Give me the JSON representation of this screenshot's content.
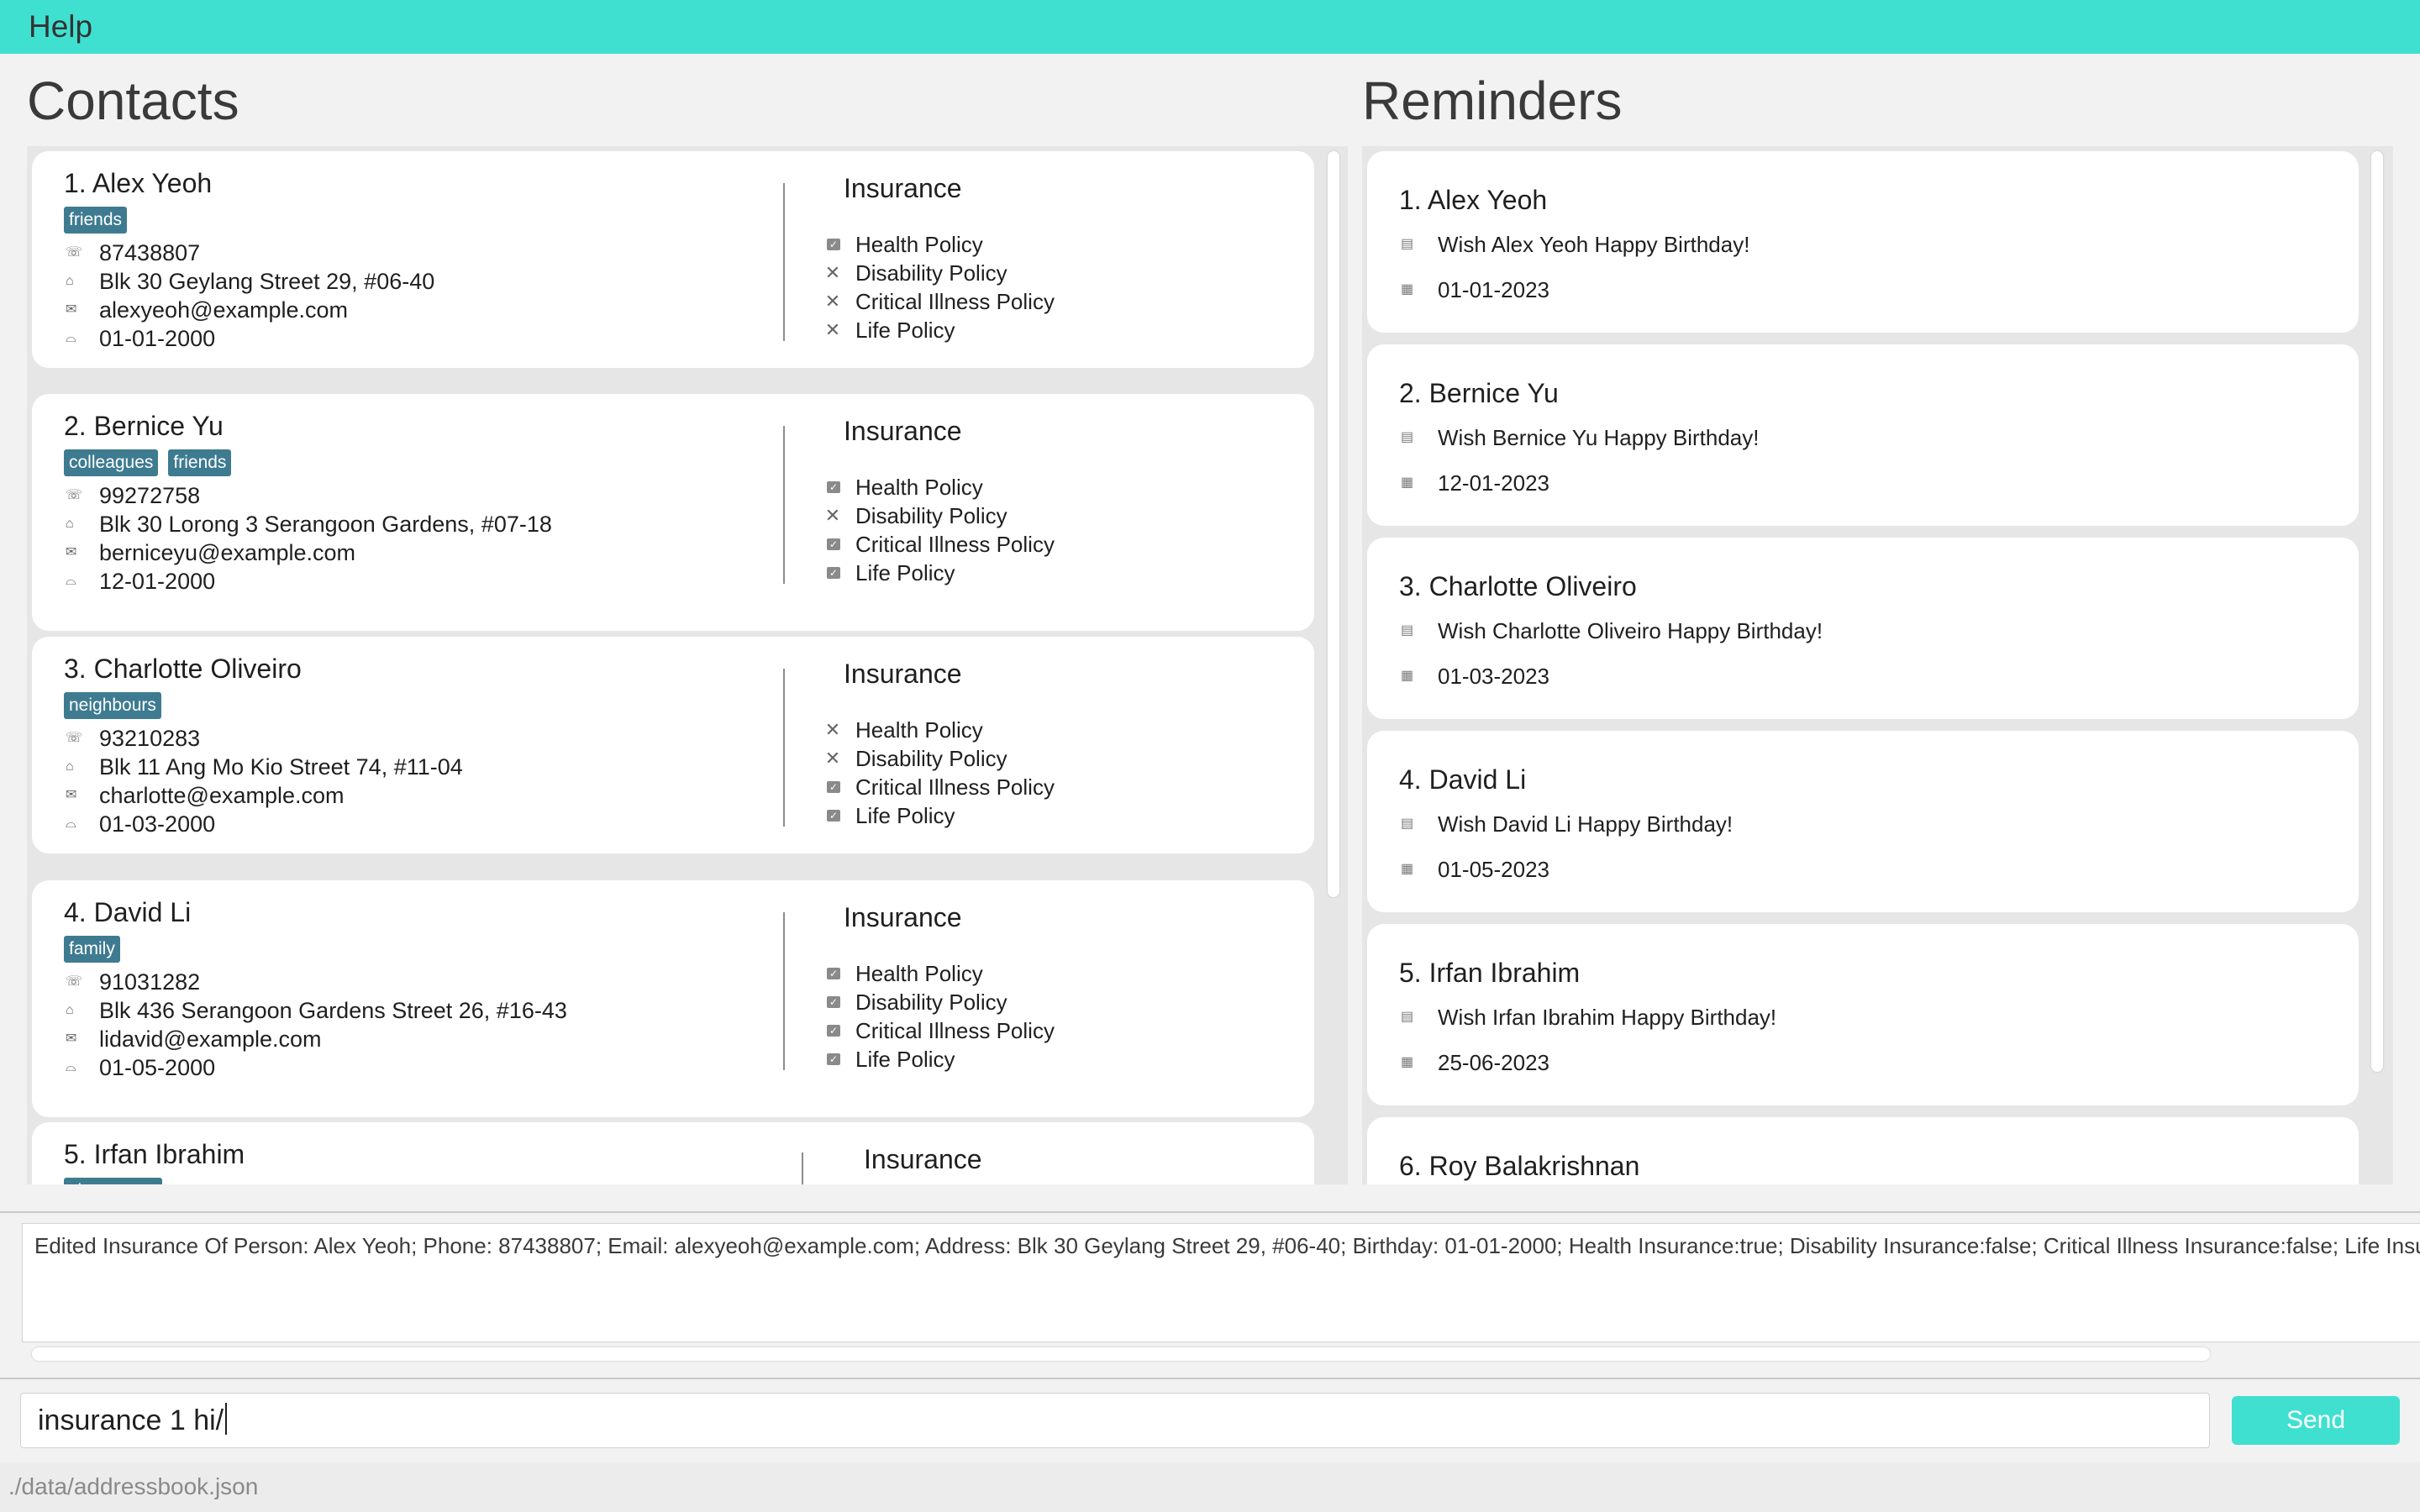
{
  "menu": {
    "help_label": "Help"
  },
  "contacts": {
    "title": "Contacts",
    "insurance_title": "Insurance",
    "items": [
      {
        "name": "1.  Alex Yeoh",
        "tags": [
          "friends"
        ],
        "phone": "87438807",
        "address": "Blk 30 Geylang Street 29, #06-40",
        "email": "alexyeoh@example.com",
        "birthday": "01-01-2000",
        "policies": [
          {
            "label": "Health Policy",
            "status": "checked"
          },
          {
            "label": "Disability Policy",
            "status": "crossed"
          },
          {
            "label": "Critical Illness Policy",
            "status": "crossed"
          },
          {
            "label": "Life Policy",
            "status": "crossed"
          }
        ]
      },
      {
        "name": "2.  Bernice Yu",
        "tags": [
          "colleagues",
          "friends"
        ],
        "phone": "99272758",
        "address": "Blk 30 Lorong 3 Serangoon Gardens, #07-18",
        "email": "berniceyu@example.com",
        "birthday": "12-01-2000",
        "policies": [
          {
            "label": "Health Policy",
            "status": "checked"
          },
          {
            "label": "Disability Policy",
            "status": "crossed"
          },
          {
            "label": "Critical Illness Policy",
            "status": "checked"
          },
          {
            "label": "Life Policy",
            "status": "checked"
          }
        ]
      },
      {
        "name": "3.  Charlotte Oliveiro",
        "tags": [
          "neighbours"
        ],
        "phone": "93210283",
        "address": "Blk 11 Ang Mo Kio Street 74, #11-04",
        "email": "charlotte@example.com",
        "birthday": "01-03-2000",
        "policies": [
          {
            "label": "Health Policy",
            "status": "crossed"
          },
          {
            "label": "Disability Policy",
            "status": "crossed"
          },
          {
            "label": "Critical Illness Policy",
            "status": "checked"
          },
          {
            "label": "Life Policy",
            "status": "checked"
          }
        ]
      },
      {
        "name": "4.  David Li",
        "tags": [
          "family"
        ],
        "phone": "91031282",
        "address": "Blk 436 Serangoon Gardens Street 26, #16-43",
        "email": "lidavid@example.com",
        "birthday": "01-05-2000",
        "policies": [
          {
            "label": "Health Policy",
            "status": "checked"
          },
          {
            "label": "Disability Policy",
            "status": "checked"
          },
          {
            "label": "Critical Illness Policy",
            "status": "checked"
          },
          {
            "label": "Life Policy",
            "status": "checked"
          }
        ]
      },
      {
        "name": "5.  Irfan Ibrahim",
        "tags": [
          "classmates"
        ],
        "phone": "",
        "address": "",
        "email": "",
        "birthday": "",
        "policies": []
      }
    ]
  },
  "reminders": {
    "title": "Reminders",
    "items": [
      {
        "name": "1.  Alex Yeoh",
        "message": "Wish Alex Yeoh Happy Birthday!",
        "date": "01-01-2023"
      },
      {
        "name": "2.  Bernice Yu",
        "message": "Wish Bernice Yu Happy Birthday!",
        "date": "12-01-2023"
      },
      {
        "name": "3.  Charlotte Oliveiro",
        "message": "Wish Charlotte Oliveiro Happy Birthday!",
        "date": "01-03-2023"
      },
      {
        "name": "4.  David Li",
        "message": "Wish David Li Happy Birthday!",
        "date": "01-05-2023"
      },
      {
        "name": "5.  Irfan Ibrahim",
        "message": "Wish Irfan Ibrahim Happy Birthday!",
        "date": "25-06-2023"
      },
      {
        "name": "6.  Roy Balakrishnan",
        "message": "",
        "date": ""
      }
    ]
  },
  "result": {
    "text": "Edited Insurance Of Person: Alex Yeoh; Phone: 87438807; Email: alexyeoh@example.com; Address: Blk 30 Geylang Street 29, #06-40; Birthday: 01-01-2000; Health Insurance:true; Disability Insurance:false; Critical Illness Insurance:false; Life Insurance:f"
  },
  "command": {
    "value": "insurance 1 hi/",
    "send_label": "Send"
  },
  "status": {
    "path": "./data/addressbook.json"
  },
  "icons": {
    "phone": "phone-icon",
    "address": "home-icon",
    "email": "email-icon",
    "birthday": "cake-icon",
    "checked": "checkbox-checked-icon",
    "crossed": "cross-icon",
    "message": "note-icon",
    "calendar": "calendar-icon"
  },
  "colors": {
    "accent": "#40e0d0",
    "tag": "#3e7b91",
    "card": "#ffffff",
    "panel": "#e6e6e6"
  }
}
